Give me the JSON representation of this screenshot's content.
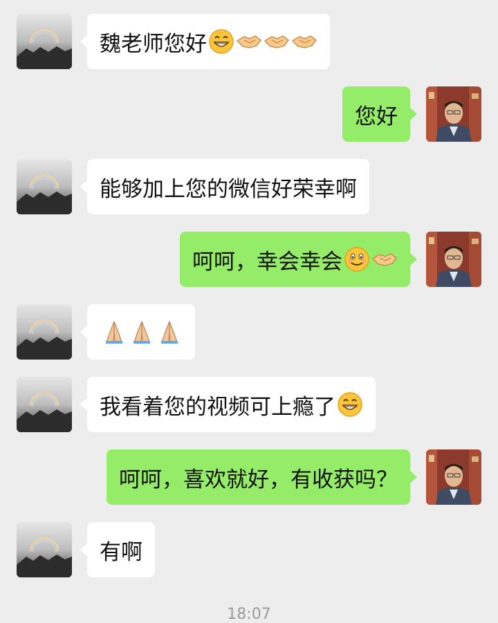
{
  "conversation": {
    "messages": [
      {
        "side": "in",
        "text": "魏老师您好",
        "emojis": [
          "grin-emoji",
          "handshake-emoji",
          "handshake-emoji",
          "handshake-emoji"
        ]
      },
      {
        "side": "out",
        "text": "您好",
        "emojis": []
      },
      {
        "side": "in",
        "text": "能够加上您的微信好荣幸啊",
        "emojis": []
      },
      {
        "side": "out",
        "text": "呵呵，幸会幸会",
        "emojis": [
          "smile-emoji",
          "handshake-emoji"
        ]
      },
      {
        "side": "in",
        "text": "",
        "emojis": [
          "pray-emoji",
          "pray-emoji",
          "pray-emoji"
        ]
      },
      {
        "side": "in",
        "text": "我看着您的视频可上瘾了",
        "emojis": [
          "grin-emoji"
        ]
      },
      {
        "side": "out",
        "text": "呵呵，喜欢就好，有收获吗？",
        "emojis": []
      },
      {
        "side": "in",
        "text": "有啊",
        "emojis": []
      }
    ],
    "timestamp": "18:07"
  },
  "colors": {
    "background": "#ededed",
    "incoming_bubble": "#ffffff",
    "outgoing_bubble": "#95ec69",
    "timestamp": "#9a9a9a"
  }
}
